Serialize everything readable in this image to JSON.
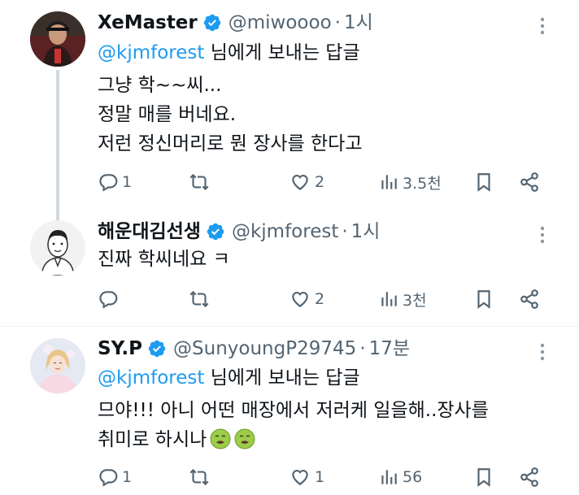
{
  "colors": {
    "text": "#0f1419",
    "secondary": "#536471",
    "link": "#1d9bf0",
    "verified": "#1d9bf0",
    "thread_line": "#cfd9de"
  },
  "tweets": [
    {
      "name": "XeMaster",
      "handle": "@miwoooo",
      "dot": "·",
      "time": "1시",
      "reply_mention": "@kjmforest",
      "reply_suffix": " 님에게 보내는 답글",
      "lines": [
        "그냥 학~~씨...",
        "정말 매를 버네요.",
        "저런 정신머리로 뭔 장사를 한다고"
      ],
      "reply_count": "1",
      "retweet_count": "",
      "like_count": "2",
      "views": "3.5천",
      "avatar_icon": "profile-photo-man-cap"
    },
    {
      "name": "해운대김선생",
      "handle": "@kjmforest",
      "dot": "·",
      "time": "1시",
      "lines": [
        "진짜 학씨네요 ㅋ"
      ],
      "reply_count": "",
      "retweet_count": "",
      "like_count": "2",
      "views": "3천",
      "avatar_icon": "profile-sketch-man"
    },
    {
      "name": "SY.P",
      "handle": "@SunyoungP29745",
      "dot": "·",
      "time": "17분",
      "reply_mention": "@kjmforest",
      "reply_suffix": " 님에게 보내는 답글",
      "lines": [
        "므야!!! 아니 어떤 매장에서 저러케 일을해..장사를",
        "취미로 하시나"
      ],
      "emojis": [
        "nauseated-face-icon",
        "nauseated-face-icon"
      ],
      "reply_count": "1",
      "retweet_count": "",
      "like_count": "1",
      "views": "56",
      "avatar_icon": "profile-cartoon-girl"
    }
  ]
}
